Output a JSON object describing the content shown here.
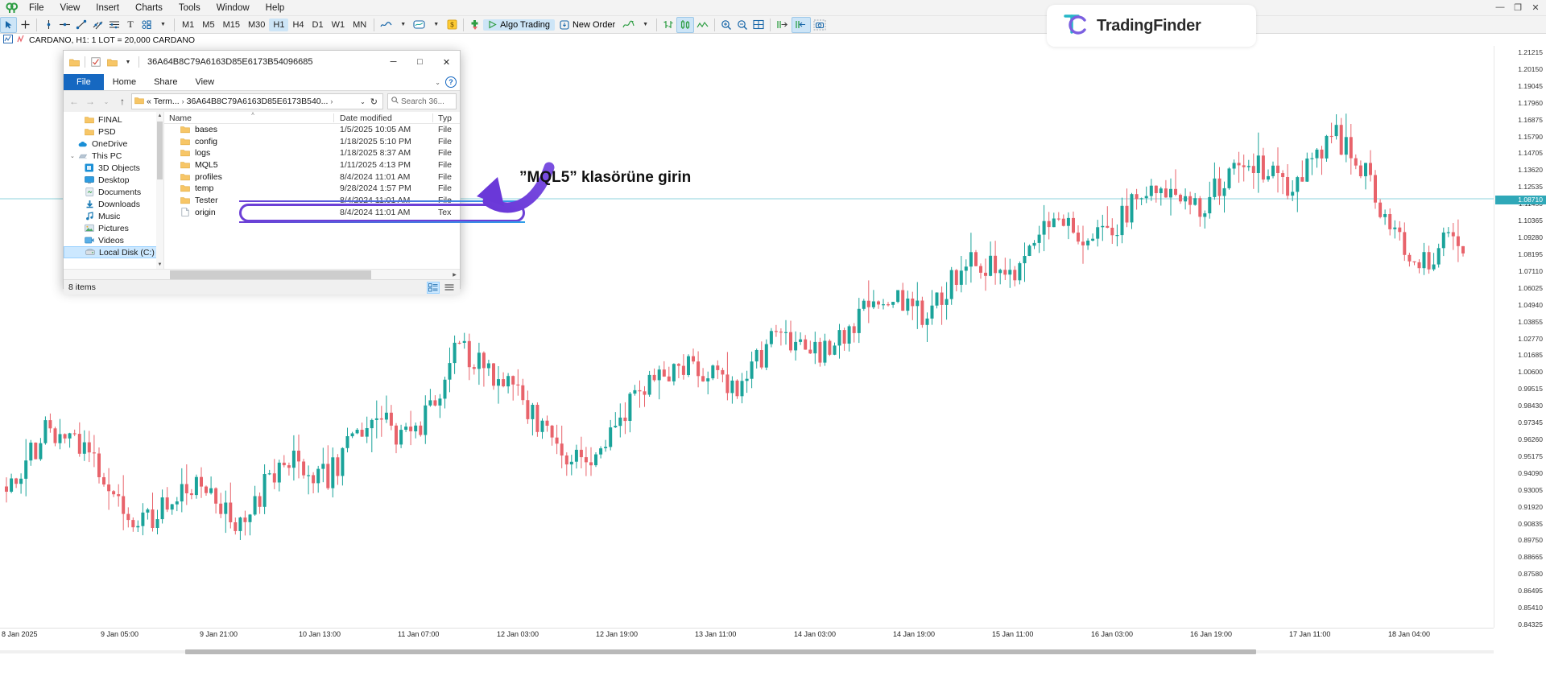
{
  "app": {
    "menu": [
      "File",
      "View",
      "Insert",
      "Charts",
      "Tools",
      "Window",
      "Help"
    ],
    "logo_icon": "metatrader-logo-icon",
    "window_buttons": {
      "minimize": "—",
      "maximize": "❐",
      "close": "✕"
    }
  },
  "toolbar": {
    "tools": [
      {
        "name": "cursor-tool",
        "glyph": "➤",
        "selected": true
      },
      {
        "name": "crosshair-tool",
        "glyph": "✚",
        "selected": false
      },
      {
        "name": "vertical-line-tool",
        "glyph": "│",
        "selected": false
      },
      {
        "name": "horizontal-line-tool",
        "glyph": "─○─",
        "selected": false
      },
      {
        "name": "trendline-tool",
        "glyph": "╱",
        "selected": false
      },
      {
        "name": "channel-tool",
        "glyph": "╱╱",
        "selected": false
      },
      {
        "name": "fibonacci-tool",
        "glyph": "≡",
        "selected": false
      },
      {
        "name": "text-tool",
        "glyph": "T",
        "selected": false
      },
      {
        "name": "shapes-tool",
        "glyph": "○□",
        "selected": false
      }
    ],
    "timeframes": [
      {
        "label": "M1",
        "selected": false
      },
      {
        "label": "M5",
        "selected": false
      },
      {
        "label": "M15",
        "selected": false
      },
      {
        "label": "M30",
        "selected": false
      },
      {
        "label": "H1",
        "selected": true
      },
      {
        "label": "H4",
        "selected": false
      },
      {
        "label": "D1",
        "selected": false
      },
      {
        "label": "W1",
        "selected": false
      },
      {
        "label": "MN",
        "selected": false
      }
    ],
    "chart_type_icon": "line-chart-icon",
    "template_icon": "template-icon",
    "indicator_icon": "dollar-indicator-icon",
    "objects_icon": "objects-icon",
    "algo_trading_label": "Algo Trading",
    "algo_trading_icon": "play-icon",
    "new_order_label": "New Order",
    "new_order_icon": "new-order-icon",
    "indicators_icon": "indicators-icon",
    "bar_chart_icon": "bar-chart-icon",
    "candles_icon": "candlestick-icon",
    "line_icon": "line-icon",
    "zoom_in_icon": "zoom-in-icon",
    "zoom_out_icon": "zoom-out-icon",
    "grid_icon": "grid-icon",
    "shift_right_icon": "shift-right-icon",
    "autoscroll_icon": "autoscroll-icon",
    "screenshot_icon": "screenshot-icon"
  },
  "symbol_bar": {
    "text": "CARDANO, H1:  1 LOT = 20,000 CARDANO",
    "icons": [
      "chart-tab-icon",
      "symbol-icon"
    ]
  },
  "watermark": {
    "brand": "TradingFinder",
    "logo_icon": "tradingfinder-logo-icon"
  },
  "explorer": {
    "title": "36A64B8C79A6163D85E6173B54096685",
    "quick_access_icons": [
      "folder-icon",
      "checkbox-icon",
      "folder-icon",
      "chevron-down-icon"
    ],
    "window_buttons": {
      "minimize": "─",
      "maximize": "□",
      "close": "✕"
    },
    "ribbon_tabs": [
      {
        "label": "File",
        "active": true
      },
      {
        "label": "Home",
        "active": false
      },
      {
        "label": "Share",
        "active": false
      },
      {
        "label": "View",
        "active": false
      }
    ],
    "help_icon": "help-icon",
    "ribbon_collapse_icon": "chevron-down-icon",
    "nav": {
      "back_icon": "arrow-left-icon",
      "forward_icon": "arrow-right-icon",
      "recent_icon": "chevron-down-icon",
      "up_icon": "arrow-up-icon"
    },
    "address": {
      "folder_icon": "folder-icon",
      "crumbs": [
        "« Term...",
        "36A64B8C79A6163D85E6173B540..."
      ],
      "separator": "›",
      "dropdown_icon": "chevron-down-icon",
      "refresh_icon": "refresh-icon"
    },
    "search": {
      "placeholder": "Search 36...",
      "icon": "search-icon"
    },
    "nav_pane": [
      {
        "label": "FINAL",
        "icon": "folder-icon",
        "level": 1,
        "expandable": false
      },
      {
        "label": "PSD",
        "icon": "folder-icon",
        "level": 1,
        "expandable": false
      },
      {
        "label": "OneDrive",
        "icon": "onedrive-icon",
        "level": 0,
        "expandable": false
      },
      {
        "label": "This PC",
        "icon": "this-pc-icon",
        "level": 0,
        "expandable": true
      },
      {
        "label": "3D Objects",
        "icon": "3d-objects-icon",
        "level": 1,
        "expandable": false
      },
      {
        "label": "Desktop",
        "icon": "desktop-icon",
        "level": 1,
        "expandable": false
      },
      {
        "label": "Documents",
        "icon": "documents-icon",
        "level": 1,
        "expandable": false
      },
      {
        "label": "Downloads",
        "icon": "downloads-icon",
        "level": 1,
        "expandable": false
      },
      {
        "label": "Music",
        "icon": "music-icon",
        "level": 1,
        "expandable": false
      },
      {
        "label": "Pictures",
        "icon": "pictures-icon",
        "level": 1,
        "expandable": false
      },
      {
        "label": "Videos",
        "icon": "videos-icon",
        "level": 1,
        "expandable": false
      },
      {
        "label": "Local Disk (C:)",
        "icon": "disk-icon",
        "level": 1,
        "expandable": false,
        "selected": true
      }
    ],
    "columns": [
      {
        "label": "Name",
        "sorted": true
      },
      {
        "label": "Date modified",
        "sorted": false
      },
      {
        "label": "Typ",
        "sorted": false
      }
    ],
    "sort_caret": "˄",
    "files": [
      {
        "name": "bases",
        "date": "1/5/2025 10:05 AM",
        "type": "File",
        "icon": "folder-icon",
        "highlighted": false
      },
      {
        "name": "config",
        "date": "1/18/2025 5:10 PM",
        "type": "File",
        "icon": "folder-icon",
        "highlighted": false
      },
      {
        "name": "logs",
        "date": "1/18/2025 8:37 AM",
        "type": "File",
        "icon": "folder-icon",
        "highlighted": false
      },
      {
        "name": "MQL5",
        "date": "1/11/2025 4:13 PM",
        "type": "File",
        "icon": "folder-icon",
        "highlighted": true
      },
      {
        "name": "profiles",
        "date": "8/4/2024 11:01 AM",
        "type": "File",
        "icon": "folder-icon",
        "highlighted": false
      },
      {
        "name": "temp",
        "date": "9/28/2024 1:57 PM",
        "type": "File",
        "icon": "folder-icon",
        "highlighted": false
      },
      {
        "name": "Tester",
        "date": "8/4/2024 11:01 AM",
        "type": "File",
        "icon": "folder-icon",
        "highlighted": false
      },
      {
        "name": "origin",
        "date": "8/4/2024 11:01 AM",
        "type": "Tex",
        "icon": "file-icon",
        "highlighted": false
      }
    ],
    "status": "8 items",
    "view_buttons": [
      {
        "name": "details-view-button",
        "icon": "details-view-icon",
        "selected": true
      },
      {
        "name": "large-icons-view-button",
        "icon": "large-icons-view-icon",
        "selected": false
      }
    ]
  },
  "annotation": {
    "text": "”MQL5” klasörüne girin",
    "arrow_icon": "curved-arrow-icon",
    "highlight_color": "#6c3fd6",
    "accent_color": "#2f9ee8"
  },
  "chart_data": {
    "type": "candlestick",
    "title": "CARDANO, H1:  1 LOT = 20,000 CARDANO",
    "symbol": "CARDANO",
    "timeframe": "H1",
    "bullish_color": "#1aa39a",
    "bearish_color": "#e8636b",
    "current_price": "1.08710",
    "current_price_bg": "#2fa8b8",
    "ylabel": "",
    "xlabel": "",
    "y_ticks": [
      "1.21215",
      "1.20150",
      "1.19045",
      "1.17960",
      "1.16875",
      "1.15790",
      "1.14705",
      "1.13620",
      "1.12535",
      "1.11450",
      "1.10365",
      "1.09280",
      "1.08195",
      "1.07110",
      "1.06025",
      "1.04940",
      "1.03855",
      "1.02770",
      "1.01685",
      "1.00600",
      "0.99515",
      "0.98430",
      "0.97345",
      "0.96260",
      "0.95175",
      "0.94090",
      "0.93005",
      "0.91920",
      "0.90835",
      "0.89750",
      "0.88665",
      "0.87580",
      "0.86495",
      "0.85410",
      "0.84325"
    ],
    "x_ticks": [
      "8 Jan 2025",
      "9 Jan 05:00",
      "9 Jan 21:00",
      "10 Jan 13:00",
      "11 Jan 07:00",
      "12 Jan 03:00",
      "12 Jan 19:00",
      "13 Jan 11:00",
      "14 Jan 03:00",
      "14 Jan 19:00",
      "15 Jan 11:00",
      "16 Jan 03:00",
      "16 Jan 19:00",
      "17 Jan 11:00",
      "18 Jan 04:00"
    ],
    "ylim": [
      0.838,
      1.217
    ],
    "grid": false,
    "series": [
      {
        "name": "CARDANO H1 OHLC",
        "note": "Uptrend from ~0.90 on 8 Jan to peak ~1.1650 near 17 Jan, then pullback to ~1.087"
      }
    ]
  }
}
